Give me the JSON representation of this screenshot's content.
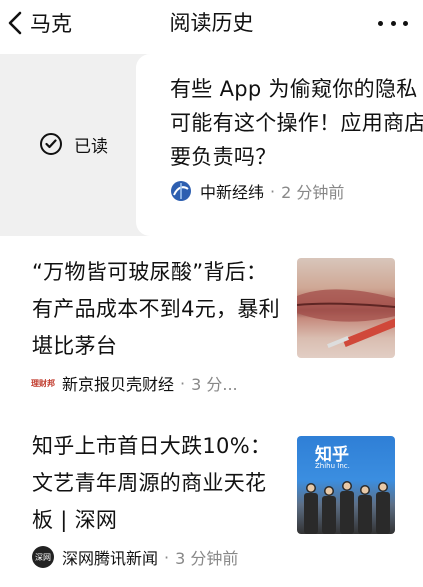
{
  "header": {
    "back_label": "马克",
    "title": "阅读历史"
  },
  "swiped_item": {
    "action_label": "已读",
    "headline": "有些 App 为偷窥你的隐私可能有这个操作！应用商店要负责吗？",
    "source": "中新经纬",
    "separator": "·",
    "time": "2 分钟前"
  },
  "articles": [
    {
      "headline": "“万物皆可玻尿酸”背后：有产品成本不到4元，暴利堪比茅台",
      "source": "新京报贝壳财经",
      "separator": "·",
      "time": "3 分...",
      "source_icon_text": "理财邦",
      "thumb_icon": "lips-injection-image"
    },
    {
      "headline": "知乎上市首日大跌10%：文艺青年周源的商业天花板 | 深网",
      "source": "深网腾讯新闻",
      "separator": "·",
      "time": "3 分钟前",
      "source_icon_text": "深网",
      "thumb_text": "知乎",
      "thumb_subtext": "Zhihu Inc.",
      "thumb_icon": "zhihu-ipo-group-photo"
    }
  ],
  "colors": {
    "text": "#111111",
    "meta": "#888888",
    "swipe_background": "#f0f0f0"
  }
}
